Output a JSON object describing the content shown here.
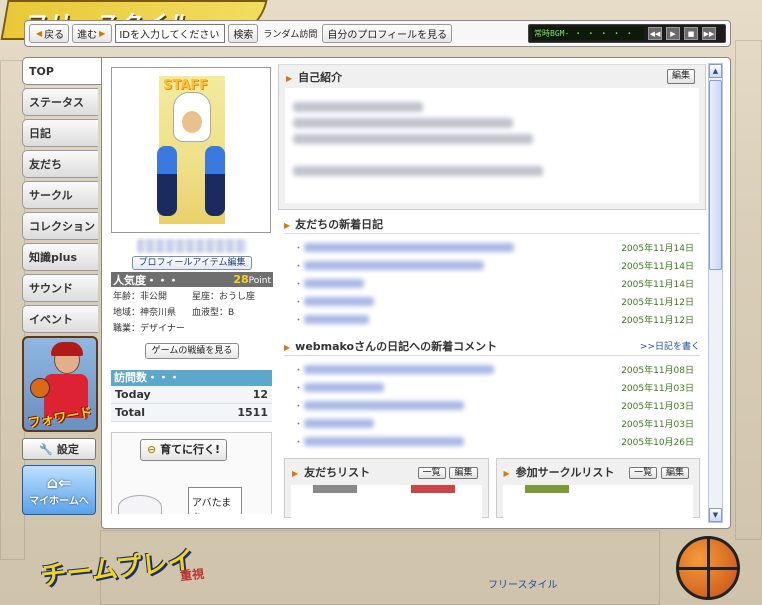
{
  "toolbar": {
    "back": "戻る",
    "forward": "進む",
    "id_placeholder": "IDを入力してください",
    "search": "検索",
    "random_visit": "ランダム訪問",
    "my_profile": "自分のプロフィールを見る",
    "bgm_text": "常時BGM- ・ ・ ・ ・ ・"
  },
  "nav": {
    "tabs": [
      "TOP",
      "ステータス",
      "日記",
      "友だち",
      "サークル",
      "コレクション",
      "知識plus",
      "サウンド",
      "イベント"
    ],
    "active": "TOP",
    "forward_banner": "フォワード",
    "settings": "設定",
    "myhome": "マイホームへ"
  },
  "profile": {
    "item_edit": "プロフィールアイテム編集",
    "popularity_label": "人気度・・・",
    "popularity_value": "28",
    "popularity_unit": "Point",
    "age": "年齢：非公開",
    "sign": "星座：おうし座",
    "region": "地域：神奈川県",
    "blood": "血液型：B",
    "job": "職業：デザイナー",
    "game_record": "ゲームの戦績を見る"
  },
  "visits": {
    "header": "訪問数・・・",
    "today_label": "Today",
    "today_value": "12",
    "total_label": "Total",
    "total_value": "1511"
  },
  "grow": {
    "button": "育てに行く!",
    "sign": "アバたまを"
  },
  "intro": {
    "title": "自己紹介",
    "edit": "編集"
  },
  "friends_diary": {
    "title": "友だちの新着日記",
    "dates": [
      "2005年11月14日",
      "2005年11月14日",
      "2005年11月14日",
      "2005年11月12日",
      "2005年11月12日"
    ]
  },
  "comments": {
    "title": "webmakoさんの日記への新着コメント",
    "write_link": ">>日記を書く",
    "dates": [
      "2005年11月08日",
      "2005年11月03日",
      "2005年11月03日",
      "2005年11月03日",
      "2005年10月26日"
    ]
  },
  "friend_list": {
    "title": "友だちリスト",
    "list_btn": "一覧",
    "edit_btn": "編集"
  },
  "circle_list": {
    "title": "参加サークルリスト",
    "list_btn": "一覧",
    "edit_btn": "編集"
  },
  "footer": {
    "link": "フリースタイル",
    "banner_main": "チームプレイ",
    "banner_sub": "重視"
  },
  "colors": {
    "visit_header": "#5da7cc",
    "popularity_bg": "#6f6f6f",
    "date_green": "#3d7a1e",
    "link_blue": "#1f4ea8",
    "triangle": "#d07a12"
  }
}
